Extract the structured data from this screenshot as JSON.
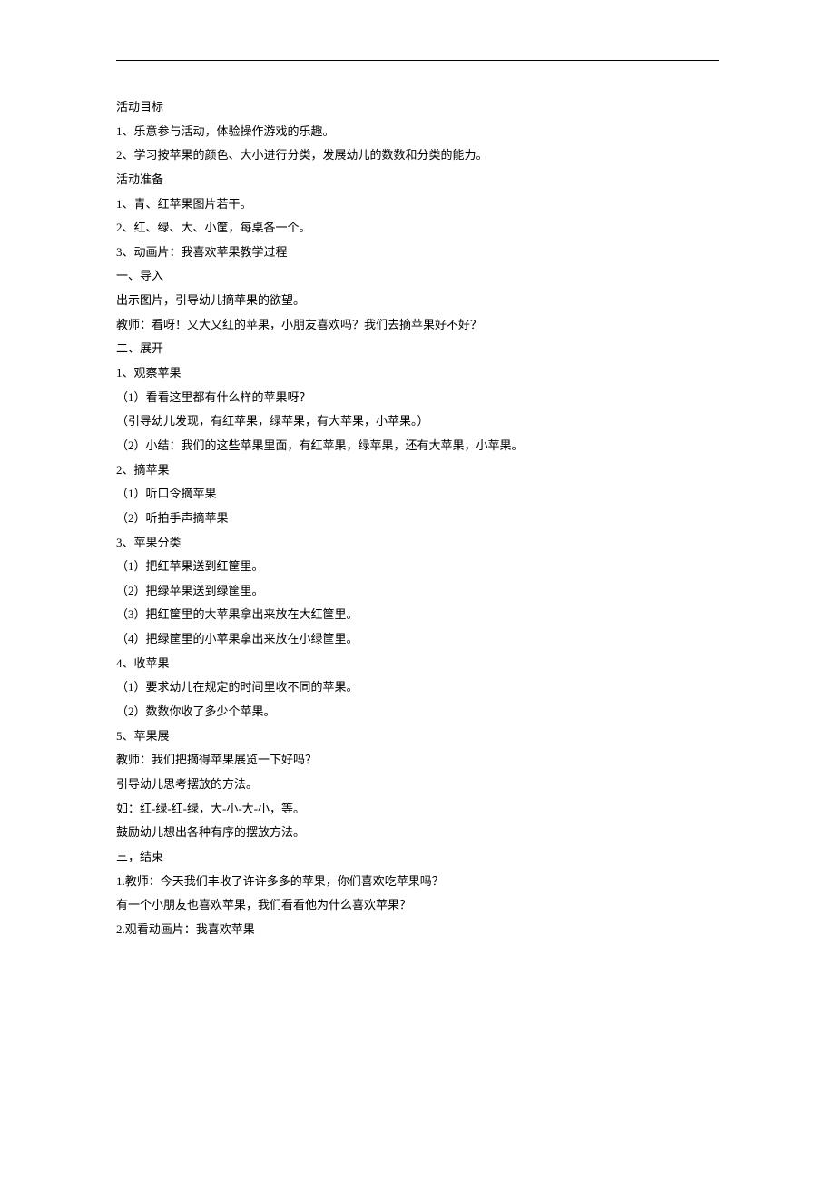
{
  "lines": [
    "活动目标",
    "1、乐意参与活动，体验操作游戏的乐趣。",
    "2、学习按苹果的颜色、大小进行分类，发展幼儿的数数和分类的能力。",
    "活动准备",
    "1、青、红苹果图片若干。",
    "2、红、绿、大、小筐，每桌各一个。",
    "3、动画片：我喜欢苹果教学过程",
    "一、导入",
    "出示图片，引导幼儿摘苹果的欲望。",
    "教师：看呀！又大又红的苹果，小朋友喜欢吗？我们去摘苹果好不好？",
    "二、展开",
    "1、观察苹果",
    "（1）看看这里都有什么样的苹果呀？",
    "（引导幼儿发现，有红苹果，绿苹果，有大苹果，小苹果。）",
    "（2）小结：我们的这些苹果里面，有红苹果，绿苹果，还有大苹果，小苹果。",
    "2、摘苹果",
    "（1）听口令摘苹果",
    "（2）听拍手声摘苹果",
    "3、苹果分类",
    "（1）把红苹果送到红筐里。",
    "（2）把绿苹果送到绿筐里。",
    "（3）把红筐里的大苹果拿出来放在大红筐里。",
    "（4）把绿筐里的小苹果拿出来放在小绿筐里。",
    "4、收苹果",
    "（1）要求幼儿在规定的时间里收不同的苹果。",
    "（2）数数你收了多少个苹果。",
    "5、苹果展",
    "教师：我们把摘得苹果展览一下好吗？",
    "引导幼儿思考摆放的方法。",
    "如：红-绿-红-绿，大-小-大-小，等。",
    "鼓励幼儿想出各种有序的摆放方法。",
    "三，结束",
    "1.教师：今天我们丰收了许许多多的苹果，你们喜欢吃苹果吗？",
    "有一个小朋友也喜欢苹果，我们看看他为什么喜欢苹果？",
    "2.观看动画片：我喜欢苹果"
  ]
}
